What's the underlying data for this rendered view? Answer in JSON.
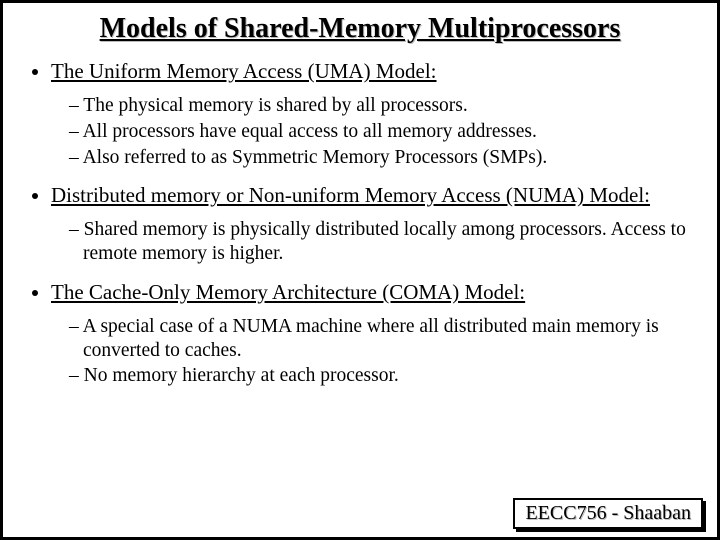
{
  "title": "Models of Shared-Memory Multiprocessors",
  "sections": [
    {
      "heading": "The Uniform Memory Access (UMA) Model:",
      "points": [
        "The physical memory is shared by all processors.",
        "All processors have equal access to all memory addresses.",
        "Also referred to as Symmetric Memory Processors (SMPs)."
      ]
    },
    {
      "heading": "Distributed memory or Non-uniform Memory Access (NUMA) Model:",
      "points": [
        "Shared memory is physically distributed locally among processors.  Access to remote memory is higher."
      ]
    },
    {
      "heading": "The Cache-Only Memory Architecture (COMA) Model:",
      "points": [
        "A special case of a NUMA machine where all distributed main memory is converted to caches.",
        "No memory hierarchy at each processor."
      ]
    }
  ],
  "footer": "EECC756 - Shaaban"
}
